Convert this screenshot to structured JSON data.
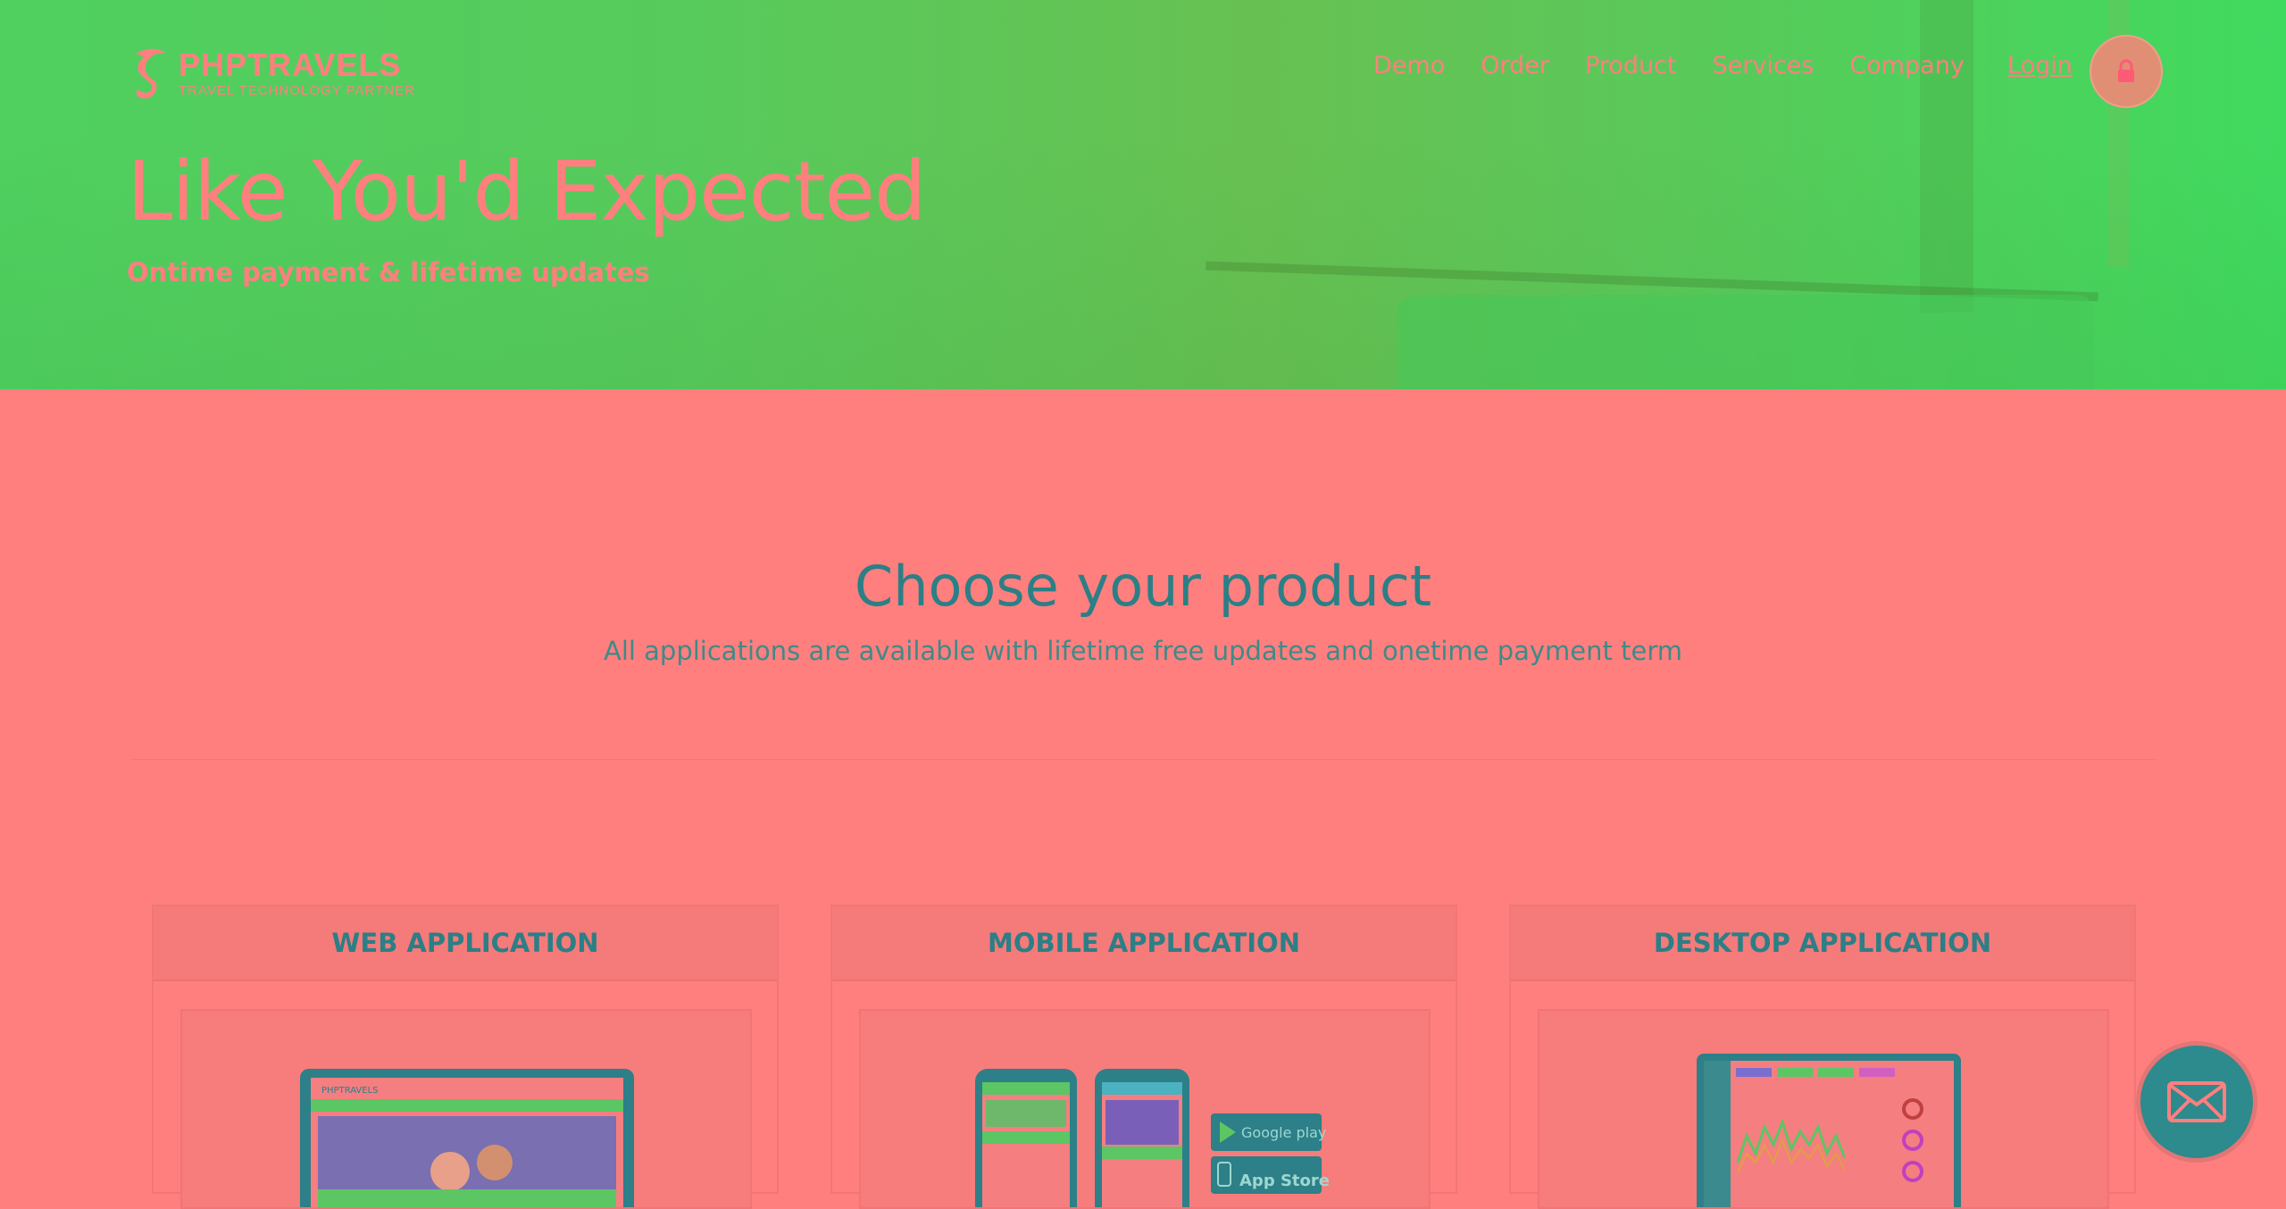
{
  "brand": {
    "name": "PHPTRAVELS",
    "tagline": "TRAVEL TECHNOLOGY PARTNER"
  },
  "nav": {
    "items": [
      "Demo",
      "Order",
      "Product",
      "Services",
      "Company"
    ],
    "login": "Login"
  },
  "hero": {
    "title": "Like You'd Expected",
    "subtitle": "Ontime payment & lifetime updates"
  },
  "section": {
    "title": "Choose your product",
    "subtitle": "All applications are available with lifetime free updates and onetime payment term"
  },
  "products": [
    {
      "title": "WEB APPLICATION",
      "image": "laptop-screenshot"
    },
    {
      "title": "MOBILE APPLICATION",
      "image": "phones-screenshot"
    },
    {
      "title": "DESKTOP APPLICATION",
      "image": "desktop-screenshot"
    }
  ],
  "store_badges": {
    "google": "Google play",
    "apple": "App Store"
  },
  "icons": {
    "lock": "lock-icon",
    "mail": "envelope-icon"
  },
  "colors": {
    "hero": "#4fd05f",
    "page": "#ff7f7f",
    "accent": "#2b7f86"
  }
}
